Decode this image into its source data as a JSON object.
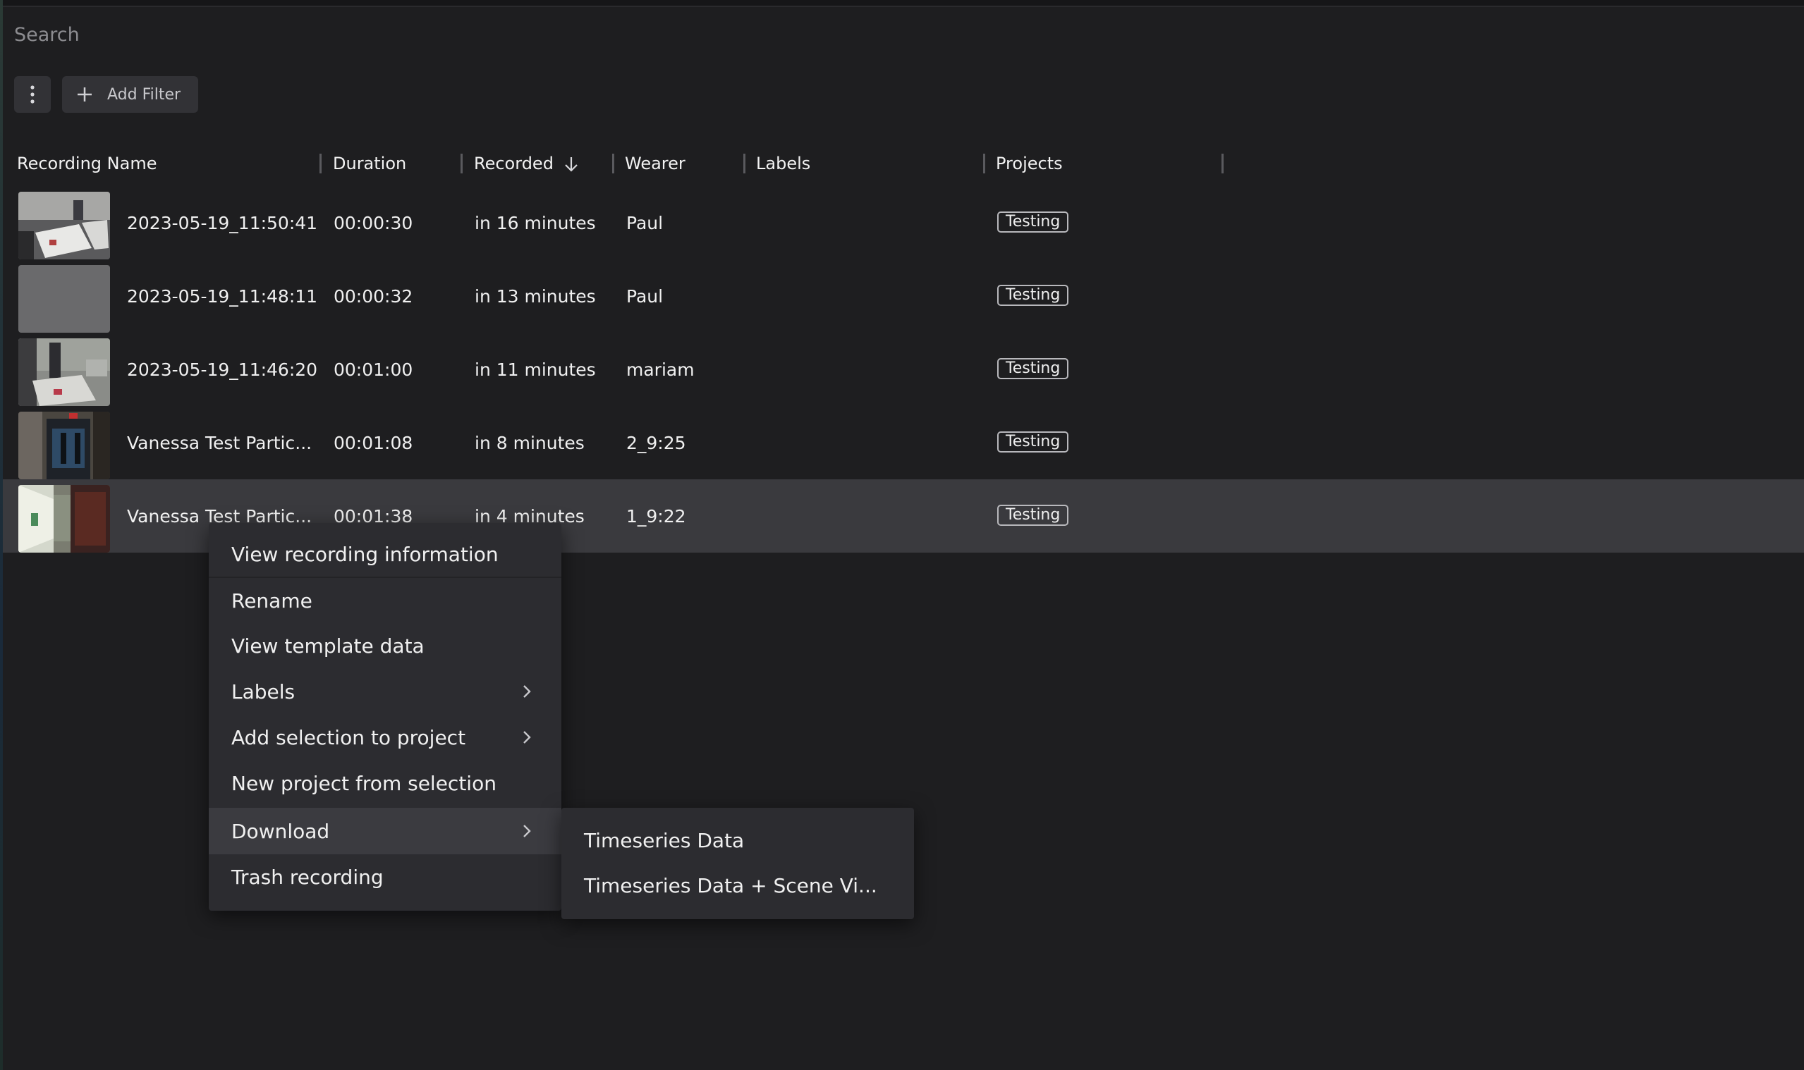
{
  "search": {
    "placeholder": "Search"
  },
  "toolbar": {
    "more_icon": "kebab-vertical-icon",
    "add_filter_label": "Add Filter",
    "add_filter_icon": "plus-icon"
  },
  "table": {
    "columns": [
      {
        "label": "Recording Name"
      },
      {
        "label": "Duration"
      },
      {
        "label": "Recorded",
        "sort": "descending",
        "sort_icon": "arrow-down-icon"
      },
      {
        "label": "Wearer"
      },
      {
        "label": "Labels"
      },
      {
        "label": "Projects"
      }
    ],
    "rows": [
      {
        "name": "2023-05-19_11:50:41",
        "duration": "00:00:30",
        "recorded": "in 16 minutes",
        "wearer": "Paul",
        "project": "Testing"
      },
      {
        "name": "2023-05-19_11:48:11",
        "duration": "00:00:32",
        "recorded": "in 13 minutes",
        "wearer": "Paul",
        "project": "Testing"
      },
      {
        "name": "2023-05-19_11:46:20",
        "duration": "00:01:00",
        "recorded": "in 11 minutes",
        "wearer": "mariam",
        "project": "Testing"
      },
      {
        "name": "Vanessa Test Partic...",
        "duration": "00:01:08",
        "recorded": "in 8 minutes",
        "wearer": "2_9:25",
        "project": "Testing"
      },
      {
        "name": "Vanessa Test Partic...",
        "duration": "00:01:38",
        "recorded": "in 4 minutes",
        "wearer": "1_9:22",
        "project": "Testing",
        "selected": true
      }
    ]
  },
  "context_menu": {
    "items": [
      {
        "label": "View recording information"
      },
      {
        "label": "Rename"
      },
      {
        "label": "View template data"
      },
      {
        "label": "Labels",
        "has_submenu": true
      },
      {
        "label": "Add selection to project",
        "has_submenu": true
      },
      {
        "label": "New project from selection"
      },
      {
        "label": "Download",
        "has_submenu": true,
        "highlighted": true
      },
      {
        "label": "Trash recording"
      }
    ],
    "chevron_icon": "chevron-right-icon"
  },
  "download_submenu": {
    "items": [
      {
        "label": "Timeseries Data"
      },
      {
        "label": "Timeseries Data + Scene Vi..."
      }
    ]
  },
  "colors": {
    "background": "#1e1e20",
    "selected_row": "#3a3a3e",
    "menu_bg": "#2c2c30",
    "menu_highlight": "#3b3b40",
    "button_bg": "#323236"
  }
}
